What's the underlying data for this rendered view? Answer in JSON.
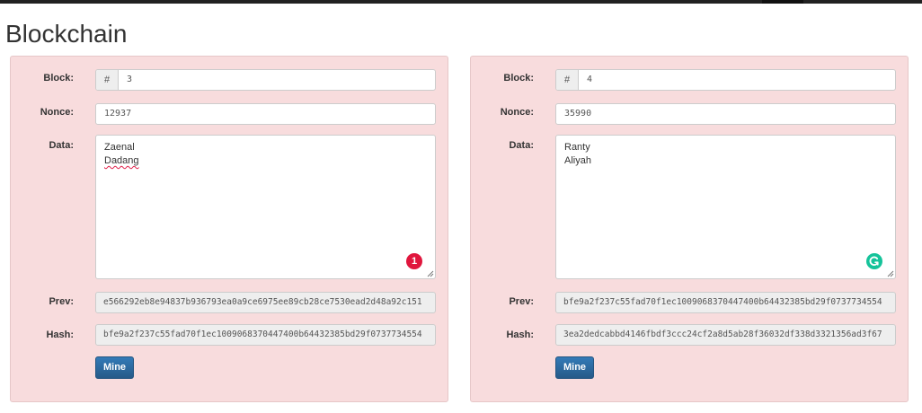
{
  "page": {
    "title": "Blockchain"
  },
  "labels": {
    "block": "Block:",
    "nonce": "Nonce:",
    "data": "Data:",
    "prev": "Prev:",
    "hash": "Hash:",
    "block_prefix": "#",
    "mine_button": "Mine"
  },
  "blocks": [
    {
      "block": "3",
      "nonce": "12937",
      "data_lines": [
        "Zaenal",
        "Dadang"
      ],
      "prev": "e566292eb8e94837b936793ea0a9ce6975ee89cb28ce7530ead2d48a92c151",
      "hash": "bfe9a2f237c55fad70f1ec1009068370447400b64432385bd29f0737734554",
      "badge": {
        "icon": "grammar-error-count-icon",
        "text": "1",
        "color": "#e0163d"
      }
    },
    {
      "block": "4",
      "nonce": "35990",
      "data_lines": [
        "Ranty",
        "Aliyah"
      ],
      "prev": "bfe9a2f237c55fad70f1ec1009068370447400b64432385bd29f0737734554",
      "hash": "3ea2dedcabbd4146fbdf3ccc24cf2a8d5ab28f36032df338d3321356ad3f67",
      "badge": {
        "icon": "grammarly-icon",
        "color": "#15c39a"
      }
    }
  ],
  "colors": {
    "panel_background": "#f8dcdd",
    "button": "#337ab7"
  }
}
